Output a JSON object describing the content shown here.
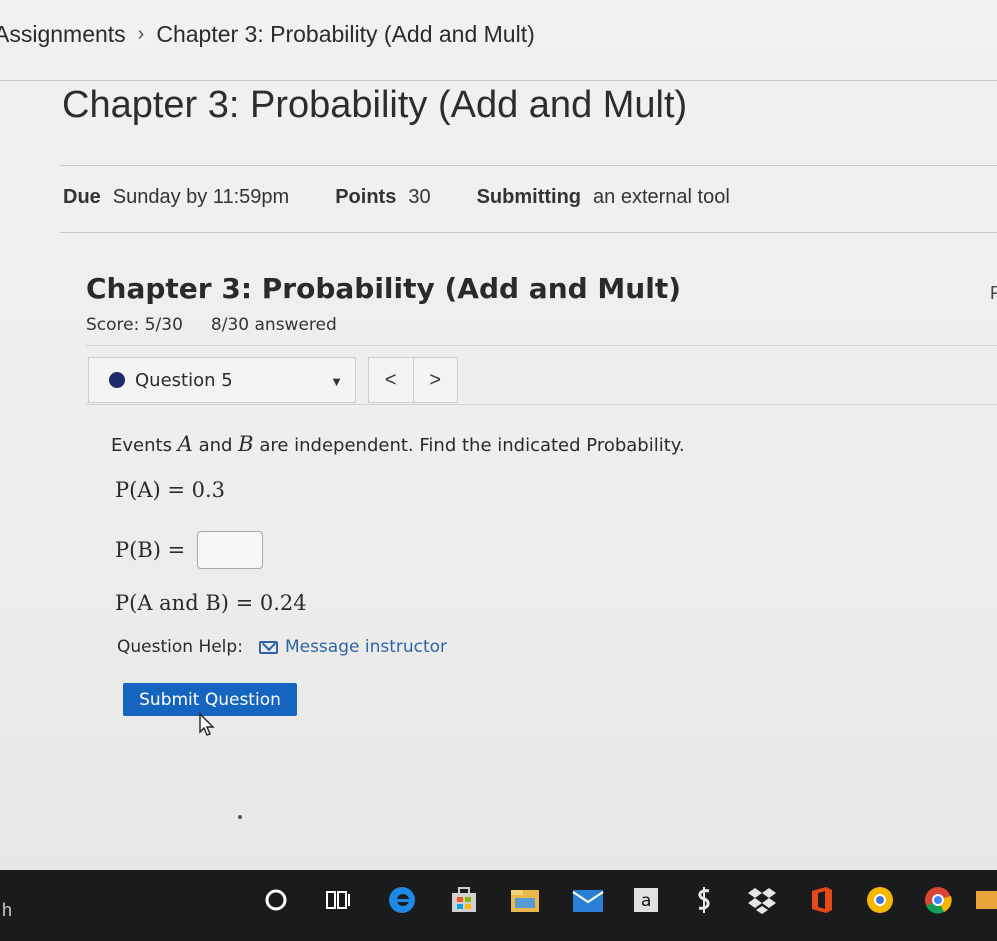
{
  "breadcrumb": {
    "root": "Assignments",
    "separator": "›",
    "current": "Chapter 3: Probability (Add and Mult)"
  },
  "assignment": {
    "title": "Chapter 3: Probability (Add and Mult)",
    "due_label": "Due",
    "due_value": "Sunday by 11:59pm",
    "points_label": "Points",
    "points_value": "30",
    "submitting_label": "Submitting",
    "submitting_value": "an external tool"
  },
  "tool": {
    "title": "Chapter 3: Probability (Add and Mult)",
    "score": "Score: 5/30",
    "answered": "8/30 answered",
    "question_select": "Question 5",
    "prev": "<",
    "next": ">"
  },
  "question": {
    "text_before": "Events ",
    "var_a": "A",
    "text_mid": " and ",
    "var_b": "B",
    "text_after": " are independent. Find the indicated Probability.",
    "line1": "P(A) = 0.3",
    "line2_label": "P(B) =",
    "line2_value": "",
    "line3": "P(A and B) = 0.24",
    "help_label": "Question Help:",
    "help_link": "Message instructor",
    "submit_label": "Submit Question"
  },
  "edge_text": "F",
  "taskbar": {
    "left_fragment": "h",
    "icons": [
      "cortana-icon",
      "task-view-icon",
      "edge-icon",
      "store-icon",
      "file-explorer-icon",
      "mail-icon",
      "amazon-icon",
      "money-icon",
      "dropbox-icon",
      "office-icon",
      "chrome-canary-icon",
      "chrome-icon",
      "extra-icon"
    ],
    "amazon_glyph": "a"
  },
  "colors": {
    "accent": "#1565c0",
    "link": "#2f63a8",
    "question_dot": "#1c2a6e",
    "taskbar": "#1b1b1d"
  }
}
